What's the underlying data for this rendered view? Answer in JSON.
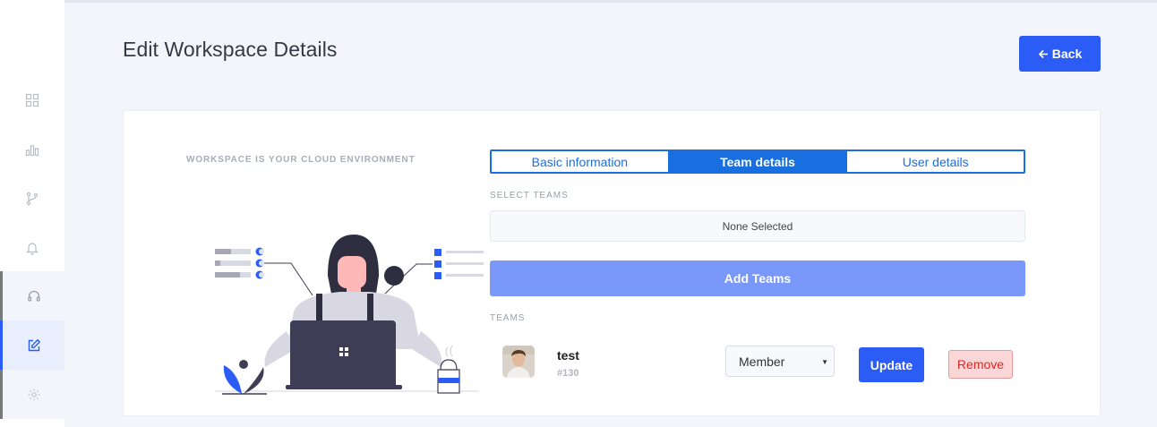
{
  "header": {
    "title": "Edit Workspace Details",
    "back_label": "Back"
  },
  "sidebar": {
    "items": [
      {
        "icon": "grid-icon"
      },
      {
        "icon": "bar-chart-icon"
      },
      {
        "icon": "git-branch-icon"
      },
      {
        "icon": "bell-icon"
      },
      {
        "icon": "headset-icon"
      },
      {
        "icon": "edit-icon",
        "active": true
      },
      {
        "icon": "gear-icon"
      }
    ]
  },
  "card": {
    "tagline": "WORKSPACE IS YOUR CLOUD ENVIRONMENT",
    "tabs": [
      {
        "label": "Basic information",
        "active": false
      },
      {
        "label": "Team details",
        "active": true
      },
      {
        "label": "User details",
        "active": false
      }
    ],
    "select_teams_label": "SELECT TEAMS",
    "select_teams_value": "None Selected",
    "add_teams_label": "Add Teams",
    "teams_label": "TEAMS",
    "teams": [
      {
        "name": "test",
        "id": "#130",
        "role": "Member",
        "update_label": "Update",
        "remove_label": "Remove"
      }
    ]
  },
  "colors": {
    "primary": "#2b5cf5",
    "tab_blue": "#1a6fe0",
    "add_button": "#7a97fa",
    "remove_bg": "#fbd6d6",
    "remove_text": "#e02424"
  }
}
